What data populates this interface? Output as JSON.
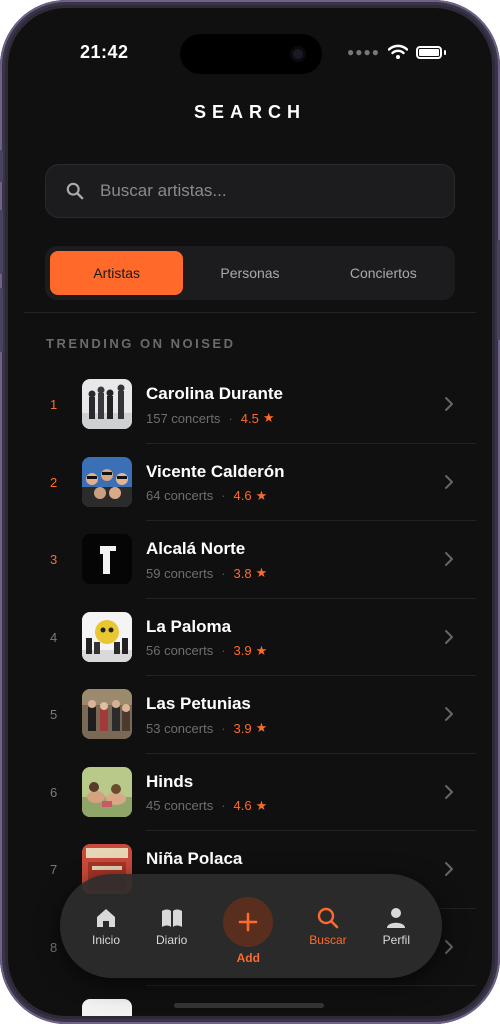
{
  "status": {
    "time": "21:42"
  },
  "header": {
    "title": "SEARCH"
  },
  "search": {
    "placeholder": "Buscar artistas..."
  },
  "segments": [
    {
      "label": "Artistas",
      "active": true
    },
    {
      "label": "Personas",
      "active": false
    },
    {
      "label": "Conciertos",
      "active": false
    }
  ],
  "section": {
    "title": "TRENDING ON NOISED"
  },
  "artists": [
    {
      "rank": "1",
      "name": "Carolina Durante",
      "concerts": "157 concerts",
      "rating": "4.5"
    },
    {
      "rank": "2",
      "name": "Vicente Calderón",
      "concerts": "64 concerts",
      "rating": "4.6"
    },
    {
      "rank": "3",
      "name": "Alcalá Norte",
      "concerts": "59 concerts",
      "rating": "3.8"
    },
    {
      "rank": "4",
      "name": "La Paloma",
      "concerts": "56 concerts",
      "rating": "3.9"
    },
    {
      "rank": "5",
      "name": "Las Petunias",
      "concerts": "53 concerts",
      "rating": "3.9"
    },
    {
      "rank": "6",
      "name": "Hinds",
      "concerts": "45 concerts",
      "rating": "4.6"
    },
    {
      "rank": "7",
      "name": "Niña Polaca",
      "concerts": "",
      "rating": ""
    },
    {
      "rank": "8",
      "name": "",
      "concerts": "",
      "rating": ""
    }
  ],
  "tabbar": {
    "items": [
      {
        "label": "Inicio",
        "icon": "home-icon"
      },
      {
        "label": "Diario",
        "icon": "book-icon"
      },
      {
        "label": "Add",
        "icon": "plus-icon"
      },
      {
        "label": "Buscar",
        "icon": "search-icon"
      },
      {
        "label": "Perfil",
        "icon": "person-icon"
      }
    ]
  },
  "colors": {
    "accent": "#ff6a2b",
    "background": "#101010",
    "card": "#1c1c1e"
  }
}
